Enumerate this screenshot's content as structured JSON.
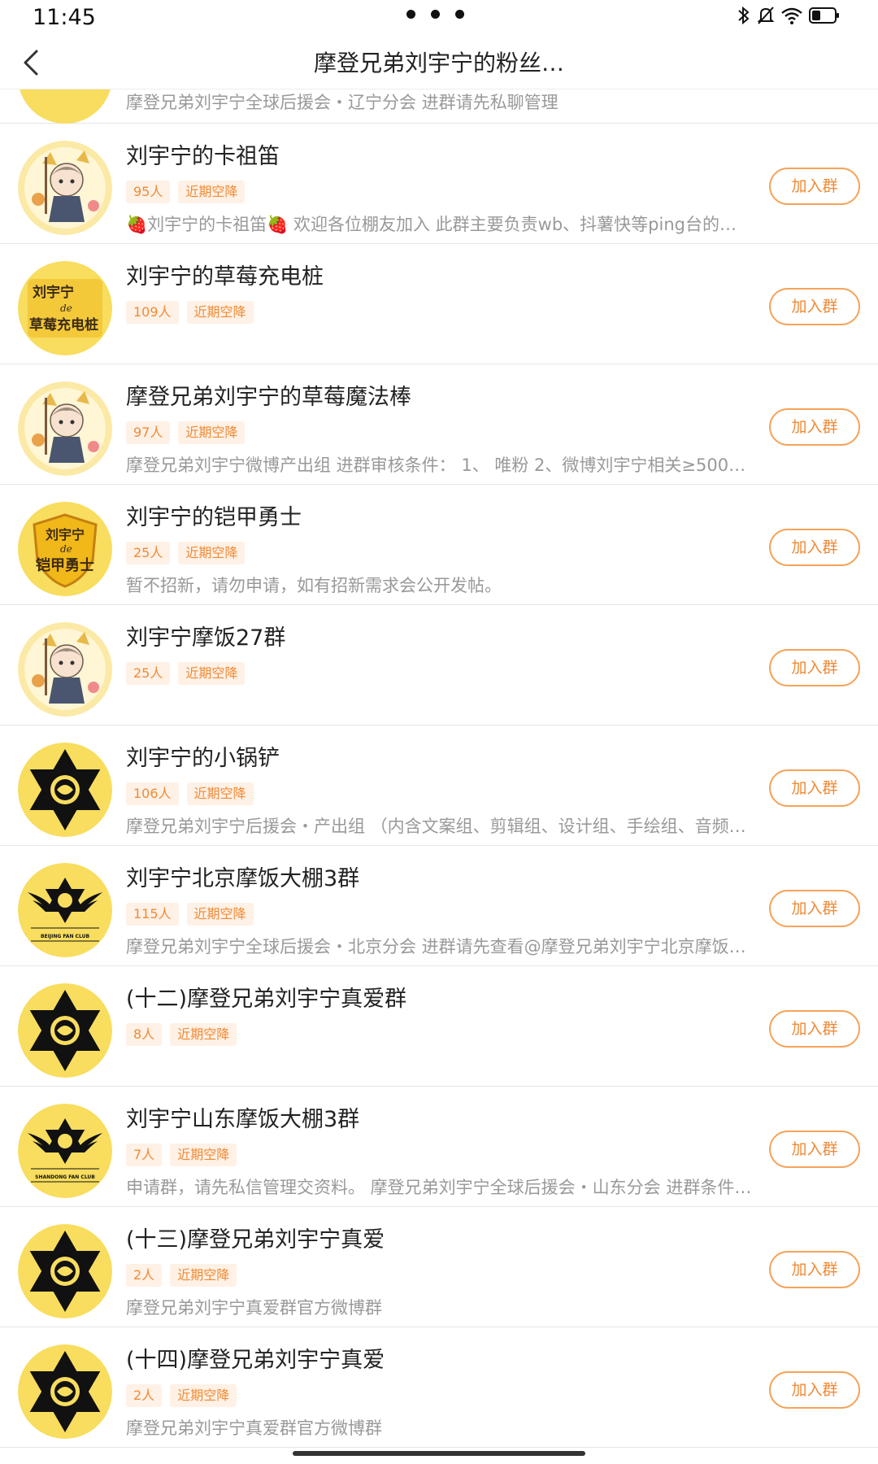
{
  "status_bar": {
    "time": "11:45"
  },
  "header": {
    "title": "摩登兄弟刘宇宁的粉丝…"
  },
  "partial_item": {
    "desc": "摩登兄弟刘宇宁全球后援会・辽宁分会 进群请先私聊管理"
  },
  "groups": [
    {
      "name": "刘宇宁的卡祖笛",
      "members": "95人",
      "tag": "近期空降",
      "desc": "🍓刘宇宁的卡祖笛🍓 欢迎各位棚友加入 此群主要负责wb、抖薯快等ping台的日…",
      "join": "加入群",
      "avatar": "cartoon"
    },
    {
      "name": "刘宇宁的草莓充电桩",
      "members": "109人",
      "tag": "近期空降",
      "desc": "",
      "join": "加入群",
      "avatar": "text-badge"
    },
    {
      "name": "摩登兄弟刘宇宁的草莓魔法棒",
      "members": "97人",
      "tag": "近期空降",
      "desc": "摩登兄弟刘宇宁微博产出组 进群审核条件： 1、 唯粉 2、微博刘宇宁相关≥500条…",
      "join": "加入群",
      "avatar": "cartoon"
    },
    {
      "name": "刘宇宁的铠甲勇士",
      "members": "25人",
      "tag": "近期空降",
      "desc": "暂不招新，请勿申请，如有招新需求会公开发帖。",
      "join": "加入群",
      "avatar": "shield-badge"
    },
    {
      "name": "刘宇宁摩饭27群",
      "members": "25人",
      "tag": "近期空降",
      "desc": "",
      "join": "加入群",
      "avatar": "cartoon"
    },
    {
      "name": "刘宇宁的小锅铲",
      "members": "106人",
      "tag": "近期空降",
      "desc": "摩登兄弟刘宇宁后援会・产出组 （内含文案组、剪辑组、设计组、手绘组、音频…",
      "join": "加入群",
      "avatar": "star-emblem"
    },
    {
      "name": "刘宇宁北京摩饭大棚3群",
      "members": "115人",
      "tag": "近期空降",
      "desc": "摩登兄弟刘宇宁全球后援会・北京分会 进群请先查看@摩登兄弟刘宇宁北京摩饭…",
      "join": "加入群",
      "avatar": "wing-emblem",
      "avatar_text": "BEIJING FAN CLUB"
    },
    {
      "name": "(十二)摩登兄弟刘宇宁真爱群",
      "members": "8人",
      "tag": "近期空降",
      "desc": "",
      "join": "加入群",
      "avatar": "star-emblem"
    },
    {
      "name": "刘宇宁山东摩饭大棚3群",
      "members": "7人",
      "tag": "近期空降",
      "desc": "申请群，请先私信管理交资料。 摩登兄弟刘宇宁全球后援会・山东分会 进群条件…",
      "join": "加入群",
      "avatar": "wing-emblem",
      "avatar_text": "SHANDONG FAN CLUB"
    },
    {
      "name": "(十三)摩登兄弟刘宇宁真爱",
      "members": "2人",
      "tag": "近期空降",
      "desc": "摩登兄弟刘宇宁真爱群官方微博群",
      "join": "加入群",
      "avatar": "star-emblem"
    },
    {
      "name": "(十四)摩登兄弟刘宇宁真爱",
      "members": "2人",
      "tag": "近期空降",
      "desc": "摩登兄弟刘宇宁真爱群官方微博群",
      "join": "加入群",
      "avatar": "star-emblem"
    }
  ],
  "badge_texts": {
    "charger": [
      "刘宇宁",
      "de",
      "草莓充电桩"
    ],
    "armor": [
      "刘宇宁",
      "de",
      "铠甲勇士"
    ]
  },
  "colors": {
    "accent": "#f08a35",
    "tag_bg": "#fff1e6",
    "avatar_yellow": "#f8dd5e"
  }
}
